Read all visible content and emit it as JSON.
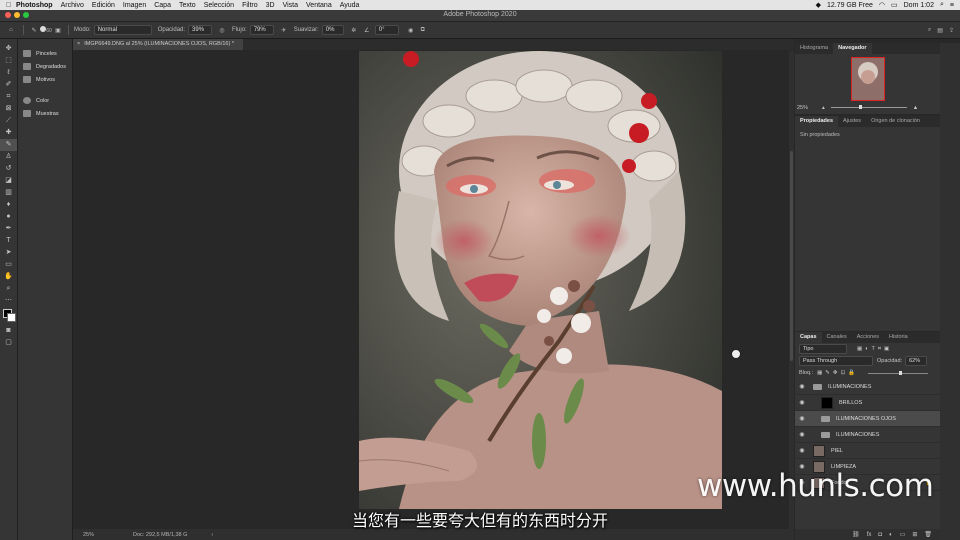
{
  "menubar": {
    "items": [
      "Photoshop",
      "Archivo",
      "Edición",
      "Imagen",
      "Capa",
      "Texto",
      "Selección",
      "Filtro",
      "3D",
      "Vista",
      "Ventana",
      "Ayuda"
    ],
    "storage": "12.79 GB Free",
    "clock": "Dom 1:02"
  },
  "window": {
    "title": "Adobe Photoshop 2020"
  },
  "options": {
    "brush_size": "60",
    "mode_label": "Modo:",
    "mode_value": "Normal",
    "opacity_label": "Opacidad:",
    "opacity_value": "39%",
    "flow_label": "Flujo:",
    "flow_value": "79%",
    "smooth_label": "Suavizar:",
    "smooth_value": "0%",
    "angle_value": "0°"
  },
  "sidepanel": {
    "items": [
      "Pinceles",
      "Degradados",
      "Motivos",
      "Color",
      "Muestras"
    ]
  },
  "document": {
    "tab_title": "IMGP6649.DNG al 25% (ILUMINACIONES OJOS, RGB/16) *",
    "zoom": "25%",
    "doc_info": "Doc: 292,5 MB/1,38 G"
  },
  "navigator": {
    "tabs": [
      "Histograma",
      "Navegador"
    ],
    "zoom": "25%"
  },
  "properties": {
    "tabs": [
      "Propiedades",
      "Ajustes",
      "Origen de clonación"
    ],
    "empty_text": "Sin propiedades"
  },
  "layers_panel": {
    "tabs": [
      "Capas",
      "Canales",
      "Acciones",
      "Historia"
    ],
    "filter": "Tipo",
    "blend_mode": "Pass Through",
    "opacity_label": "Opacidad:",
    "opacity_value": "62%",
    "lock_label": "Bloq.:",
    "fill_label": "Relleno:",
    "layers": [
      {
        "name": "ILUMINACIONES",
        "kind": "group",
        "indent": 0
      },
      {
        "name": "BRILLOS",
        "kind": "adjustment",
        "indent": 1
      },
      {
        "name": "ILUMINACIONES OJOS",
        "kind": "group",
        "indent": 1,
        "selected": true
      },
      {
        "name": "ILUMINACIONES",
        "kind": "group",
        "indent": 1
      },
      {
        "name": "PIEL",
        "kind": "pixel",
        "indent": 0
      },
      {
        "name": "LIMPIEZA",
        "kind": "pixel",
        "indent": 0
      },
      {
        "name": "Fondo",
        "kind": "pixel",
        "indent": 0
      }
    ]
  },
  "tools": [
    "move-tool",
    "marquee-tool",
    "lasso-tool",
    "quick-select-tool",
    "crop-tool",
    "frame-tool",
    "eyedropper-tool",
    "healing-tool",
    "brush-tool",
    "stamp-tool",
    "history-brush-tool",
    "eraser-tool",
    "gradient-tool",
    "blur-tool",
    "dodge-tool",
    "pen-tool",
    "type-tool",
    "path-select-tool",
    "shape-tool",
    "hand-tool",
    "zoom-tool"
  ],
  "overlay": {
    "subtitle": "当您有一些要夸大但有的东西时分开",
    "watermark": "www.hunls.com"
  },
  "colors": {
    "accent": "#1473e6",
    "panel": "#353535",
    "canvas_bg": "#282828"
  }
}
